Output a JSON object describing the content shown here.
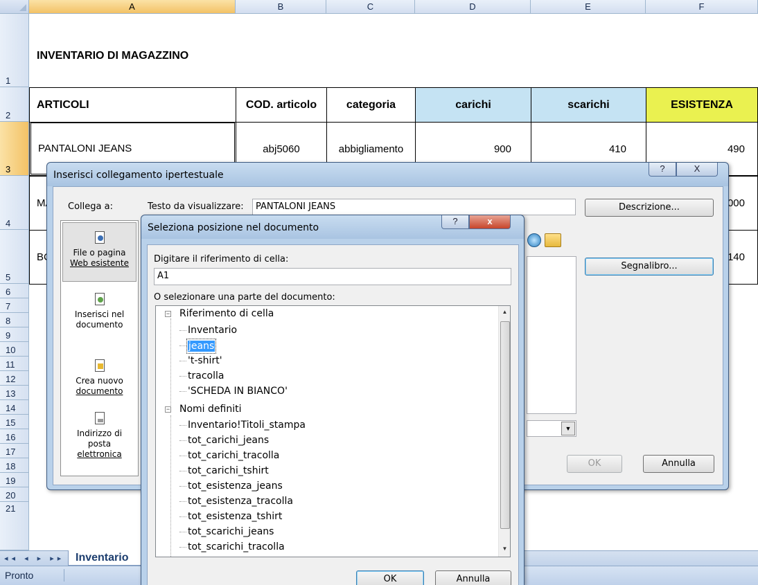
{
  "spreadsheet": {
    "columns": [
      "A",
      "B",
      "C",
      "D",
      "E",
      "F"
    ],
    "rows": [
      "1",
      "2",
      "3",
      "4",
      "5",
      "6",
      "7",
      "8",
      "9",
      "10",
      "11",
      "12",
      "13",
      "14",
      "15",
      "16",
      "17",
      "18",
      "19",
      "20",
      "21"
    ],
    "title": "INVENTARIO DI MAGAZZINO",
    "headers": {
      "articoli": "ARTICOLI",
      "codice": "COD. articolo",
      "categoria": "categoria",
      "carichi": "carichi",
      "scarichi": "scarichi",
      "esistenza": "ESISTENZA"
    },
    "row3": {
      "articolo": "PANTALONI JEANS",
      "codice": "abj5060",
      "categoria": "abbigliamento",
      "carichi": "900",
      "scarichi": "410",
      "esistenza": "490"
    },
    "row4": {
      "articolo_partial": "MA",
      "esistenza_partial": ".000"
    },
    "row5": {
      "articolo_partial": "BC",
      "esistenza_partial": "140"
    },
    "colors": {
      "carichi_bg": "#c5e3f3",
      "esistenza_bg": "#eaf150"
    },
    "sheet_tab": "Inventario",
    "tab_nav": "◂◂ ◂ ▸ ▸▸",
    "status": "Pronto"
  },
  "hyperlink_dialog": {
    "title": "Inserisci collegamento ipertestuale",
    "help_btn": "?",
    "close_btn": "X",
    "collega_label": "Collega a:",
    "testo_label": "Testo da visualizzare:",
    "testo_value": "PANTALONI JEANS",
    "descrizione_btn": "Descrizione...",
    "segnalibro_btn": "Segnalibro...",
    "ok_btn": "OK",
    "annulla_btn": "Annulla",
    "link_items": [
      {
        "label_1": "File o pagina",
        "label_2": "Web esistente",
        "icon": "web-page-icon"
      },
      {
        "label_1": "Inserisci nel",
        "label_2": "documento",
        "icon": "document-place-icon"
      },
      {
        "label_1": "Crea nuovo",
        "label_2": "documento",
        "icon": "new-document-icon"
      },
      {
        "label_1": "Indirizzo di",
        "label_2": "posta",
        "label_3": "elettronica",
        "icon": "email-icon"
      }
    ]
  },
  "location_dialog": {
    "title": "Seleziona posizione nel documento",
    "help_btn": "?",
    "close_btn": "x",
    "ref_label": "Digitare il riferimento di cella:",
    "ref_value": "A1",
    "part_label": "O selezionare una parte del documento:",
    "tree": {
      "group1": "Riferimento di cella",
      "group1_items": [
        "Inventario",
        "jeans",
        "'t-shirt'",
        "tracolla",
        "'SCHEDA IN BIANCO'"
      ],
      "group2": "Nomi definiti",
      "group2_items": [
        "Inventario!Titoli_stampa",
        "tot_carichi_jeans",
        "tot_carichi_tracolla",
        "tot_carichi_tshirt",
        "tot_esistenza_jeans",
        "tot_esistenza_tracolla",
        "tot_esistenza_tshirt",
        "tot_scarichi_jeans",
        "tot_scarichi_tracolla"
      ],
      "selected": "jeans"
    },
    "ok_btn": "OK",
    "annulla_btn": "Annulla"
  }
}
